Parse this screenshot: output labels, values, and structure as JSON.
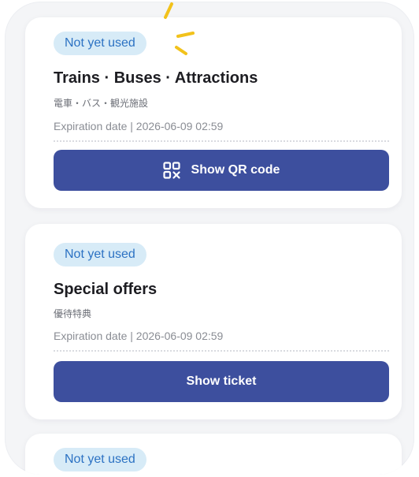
{
  "tickets": [
    {
      "status": "Not yet used",
      "title": "Trains · Buses · Attractions",
      "subtitle": "電車・バス・観光施設",
      "expiration": "Expiration date | 2026-06-09 02:59",
      "button_label": "Show QR code",
      "button_icon": "qr-code-icon"
    },
    {
      "status": "Not yet used",
      "title": "Special offers",
      "subtitle": "優待特典",
      "expiration": "Expiration date | 2026-06-09 02:59",
      "button_label": "Show ticket"
    },
    {
      "status": "Not yet used"
    }
  ],
  "colors": {
    "badge_bg": "#d7ebf7",
    "badge_text": "#2c72c3",
    "button_bg": "#3d4f9e",
    "sparkle": "#f2c21b"
  }
}
